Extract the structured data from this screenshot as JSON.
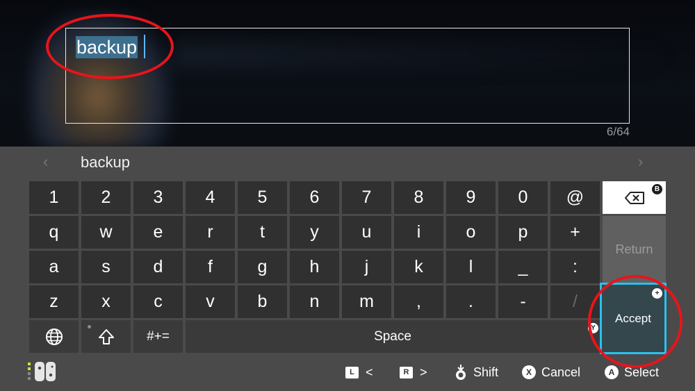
{
  "input": {
    "text": "backup",
    "char_count": "6/64"
  },
  "suggestions": {
    "prev_arrow": "‹",
    "next_arrow": "›",
    "word": "backup"
  },
  "keyboard": {
    "rows": [
      [
        "1",
        "2",
        "3",
        "4",
        "5",
        "6",
        "7",
        "8",
        "9",
        "0",
        "@"
      ],
      [
        "q",
        "w",
        "e",
        "r",
        "t",
        "y",
        "u",
        "i",
        "o",
        "p",
        "+"
      ],
      [
        "a",
        "s",
        "d",
        "f",
        "g",
        "h",
        "j",
        "k",
        "l",
        "_",
        ":"
      ],
      [
        "z",
        "x",
        "c",
        "v",
        "b",
        "n",
        "m",
        ",",
        ".",
        "-",
        "/"
      ]
    ],
    "globe_icon": "globe-icon",
    "shift_icon": "shift-arrow-icon",
    "symbols_label": "#+=",
    "space_label": "Space",
    "backspace_icon": "backspace-icon",
    "backspace_badge": "B",
    "return_label": "Return",
    "accept_label": "Accept",
    "accept_badge": "+",
    "space_badge": "Y"
  },
  "footer": {
    "left_badge": "L",
    "left_arrow": "<",
    "right_badge": "R",
    "right_arrow": ">",
    "shift_label": "Shift",
    "cancel_badge": "X",
    "cancel_label": "Cancel",
    "select_badge": "A",
    "select_label": "Select"
  },
  "colors": {
    "accept_border": "#29c1f0",
    "annotation": "#e8141b",
    "controller_accent": "#c4e538"
  }
}
